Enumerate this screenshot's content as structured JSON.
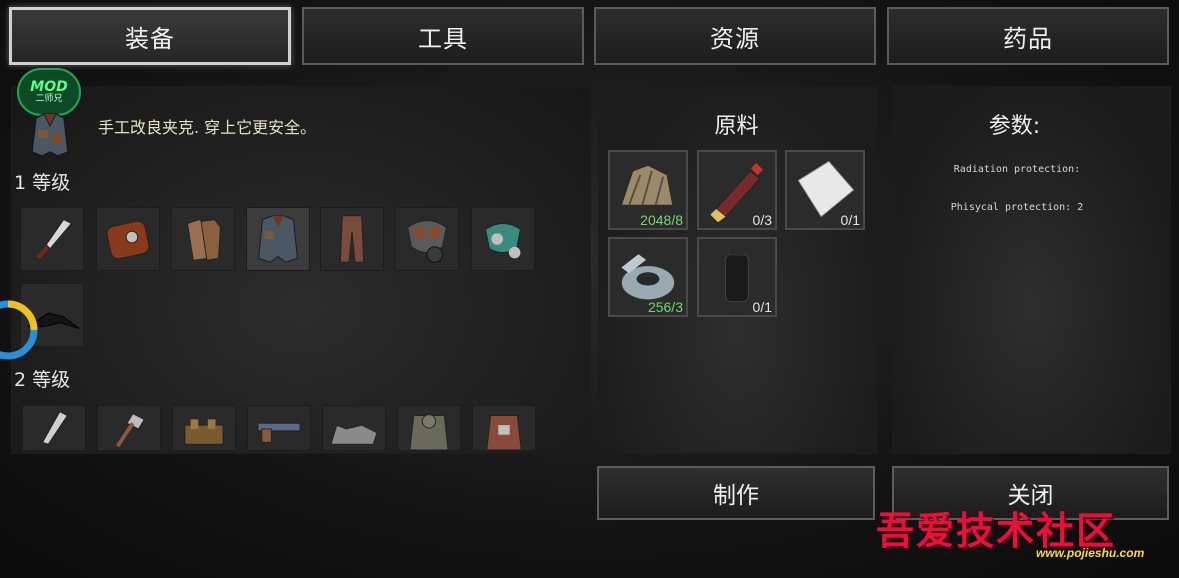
{
  "tabs": [
    {
      "label": "装备",
      "active": true
    },
    {
      "label": "工具",
      "active": false
    },
    {
      "label": "资源",
      "active": false
    },
    {
      "label": "药品",
      "active": false
    }
  ],
  "mod_badge": {
    "line1": "MOD",
    "line2": "二师兄"
  },
  "item_description": "手工改良夹克. 穿上它更安全。",
  "levels": [
    {
      "label": "1 等级"
    },
    {
      "label": "2 等级"
    }
  ],
  "level1_items": [
    "knife-icon",
    "backpack-icon",
    "gloves-icon",
    "jacket-icon",
    "pants-icon",
    "gas-mask-icon",
    "respirator-icon",
    "crow-icon"
  ],
  "level2_items": [
    "blade-icon",
    "axe-icon",
    "belt-icon",
    "pistol-icon",
    "wolf-icon",
    "armor-icon",
    "vest-icon"
  ],
  "craft_progress": {
    "fraction": 0.4,
    "colors": [
      "#f0c020",
      "#2a8fd6"
    ]
  },
  "materials": {
    "title": "原料",
    "items": [
      {
        "icon": "rags-icon",
        "count": "2048/8",
        "ok": true
      },
      {
        "icon": "glue-tube-icon",
        "count": "0/3",
        "ok": false
      },
      {
        "icon": "paper-icon",
        "count": "0/1",
        "ok": false
      },
      {
        "icon": "duct-tape-icon",
        "count": "256/3",
        "ok": true
      },
      {
        "icon": "canister-icon",
        "count": "0/1",
        "ok": false
      }
    ]
  },
  "params": {
    "title": "参数:",
    "lines": [
      "Radiation protection:",
      "Phisycal protection: 2"
    ]
  },
  "buttons": {
    "craft": "制作",
    "close": "关闭"
  },
  "watermark": {
    "main": "吾爱技术社区",
    "url": "www.pojieshu.com"
  },
  "colors": {
    "count_ok": "#6fd96f",
    "count_missing": "#e4e4e4",
    "watermark": "#e3133b"
  }
}
